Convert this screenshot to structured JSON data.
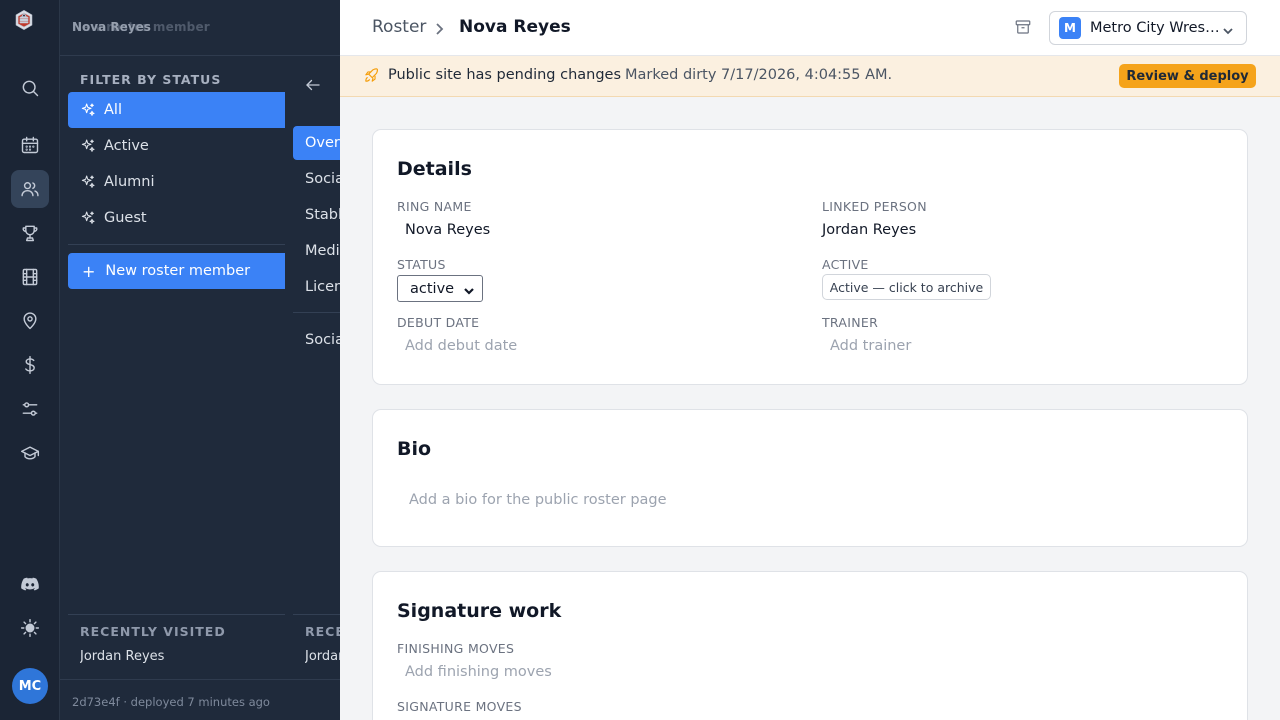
{
  "app": {
    "header_primary": "Nova Reyes",
    "header_overlay": "New roster member"
  },
  "rail": {
    "icons": [
      "logo-icon",
      "search-icon",
      "calendar-icon",
      "users-icon",
      "trophy-icon",
      "film-icon",
      "map-pin-icon",
      "dollar-icon",
      "sliders-icon",
      "graduation-cap-icon",
      "discord-icon",
      "sun-icon"
    ],
    "active_icon": "users-icon",
    "avatar_initials": "MC",
    "avatar_color": "#2f76d9"
  },
  "sidebar": {
    "filter_label": "FILTER BY STATUS",
    "filters": [
      {
        "label": "All",
        "selected": true
      },
      {
        "label": "Active",
        "selected": false
      },
      {
        "label": "Alumni",
        "selected": false
      },
      {
        "label": "Guest",
        "selected": false
      }
    ],
    "new_button": "New roster member",
    "sub_nav": [
      {
        "label": "Overview",
        "selected": true
      },
      {
        "label": "Social",
        "selected": false
      },
      {
        "label": "Stable",
        "selected": false
      },
      {
        "label": "Media",
        "selected": false
      },
      {
        "label": "Licenses",
        "selected": false
      },
      {
        "label": "Social",
        "selected": false
      }
    ],
    "recent_label": "RECENTLY VISITED",
    "recent_items": [
      "Jordan Reyes"
    ],
    "recent_label_clipped": "RECENTLY VISITED",
    "recent_items_clipped": [
      "Jordan Reyes"
    ],
    "footer_hash": "2d73e4f",
    "footer_text": "· deployed 7 minutes ago"
  },
  "topbar": {
    "breadcrumb_parent": "Roster",
    "breadcrumb_current": "Nova Reyes",
    "org_badge": "M",
    "org_name": "Metro City Wrestling"
  },
  "banner": {
    "message": "Public site has pending changes",
    "sub": "Marked dirty 7/17/2026, 4:04:55 AM.",
    "button": "Review & deploy",
    "accent": "#f5a31a"
  },
  "details": {
    "title": "Details",
    "ring_name_label": "RING NAME",
    "ring_name": "Nova Reyes",
    "linked_person_label": "LINKED PERSON",
    "linked_person": "Jordan Reyes",
    "status_label": "STATUS",
    "status_value": "active",
    "active_label": "ACTIVE",
    "active_button": "Active — click to archive",
    "debut_label": "DEBUT DATE",
    "debut_placeholder": "Add debut date",
    "trainer_label": "TRAINER",
    "trainer_placeholder": "Add trainer"
  },
  "bio": {
    "title": "Bio",
    "placeholder": "Add a bio for the public roster page"
  },
  "signature": {
    "title": "Signature work",
    "finishing_label": "FINISHING MOVES",
    "finishing_placeholder": "Add finishing moves",
    "signature_label": "SIGNATURE MOVES"
  }
}
